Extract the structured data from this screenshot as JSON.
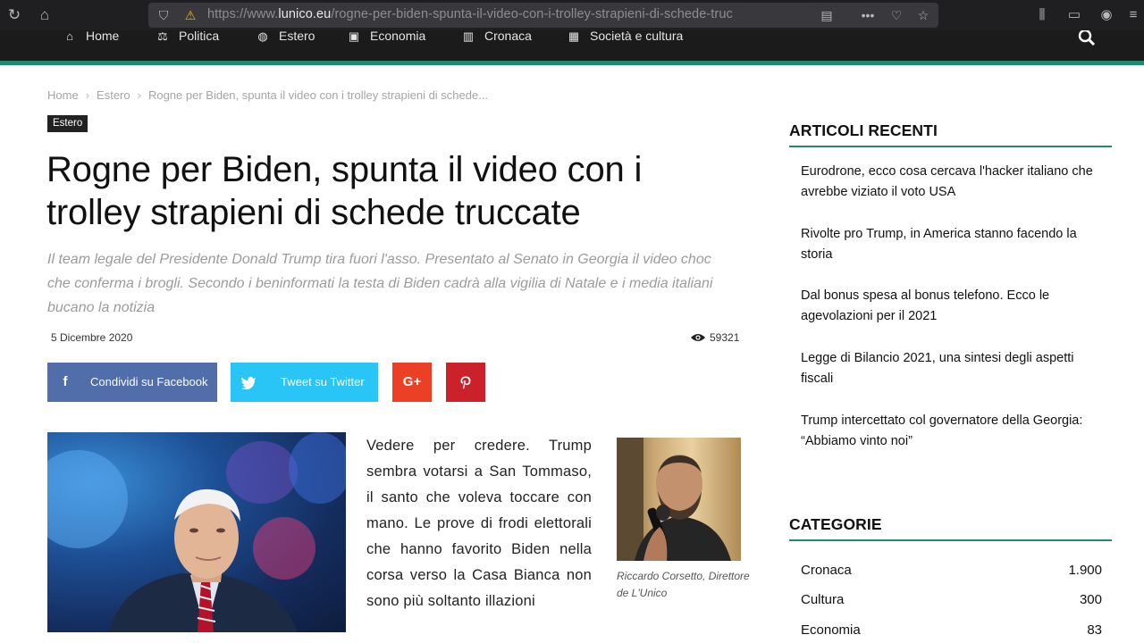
{
  "browser": {
    "url_prefix": "https://www.",
    "url_host": "lunico.eu",
    "url_path": "/rogne-per-biden-spunta-il-video-con-i-trolley-strapieni-di-schede-truc"
  },
  "nav": {
    "items": [
      {
        "label": "Home",
        "icon": "home-icon"
      },
      {
        "label": "Politica",
        "icon": "balance-icon"
      },
      {
        "label": "Estero",
        "icon": "globe-icon"
      },
      {
        "label": "Economia",
        "icon": "money-icon"
      },
      {
        "label": "Cronaca",
        "icon": "newspaper-icon"
      },
      {
        "label": "Società e cultura",
        "icon": "building-icon"
      }
    ]
  },
  "breadcrumb": [
    "Home",
    "Estero",
    "Rogne per Biden, spunta il video con i trolley strapieni di schede..."
  ],
  "article": {
    "category": "Estero",
    "title": "Rogne per Biden, spunta il video con i trolley strapieni di schede truccate",
    "subtitle": "Il team legale del Presidente Donald Trump tira fuori l'asso. Presentato al Senato in Georgia il video choc che conferma i brogli. Secondo i beninformati la testa di Biden cadrà alla vigilia di Natale e i media italiani bucano la notizia",
    "date": "5 Dicembre 2020",
    "views": "59321",
    "share": {
      "facebook": "Condividi su Facebook",
      "twitter": "Tweet su Twitter"
    },
    "body": "Vedere per credere. Trump sembra votarsi a San Tommaso, il santo che voleva toccare con mano. Le prove di frodi elettorali che hanno favorito Biden nella corsa verso la Casa Bianca non sono più soltanto illazioni",
    "author_caption": "Riccardo Corsetto, Direttore de L'Unico"
  },
  "sidebar": {
    "recent_title": "ARTICOLI RECENTI",
    "recent": [
      "Eurodrone, ecco cosa cercava l'hacker italiano che avrebbe viziato il voto USA",
      "Rivolte pro Trump, in America stanno facendo la storia",
      "Dal bonus spesa al bonus telefono. Ecco le agevolazioni per il 2021",
      "Legge di Bilancio 2021, una sintesi degli aspetti fiscali",
      "Trump intercettato col governatore della Georgia: “Abbiamo vinto noi”"
    ],
    "categories_title": "CATEGORIE",
    "categories": [
      {
        "name": "Cronaca",
        "count": "1.900"
      },
      {
        "name": "Cultura",
        "count": "300"
      },
      {
        "name": "Economia",
        "count": "83"
      }
    ]
  },
  "colors": {
    "accent": "#1f8a70",
    "facebook": "#516eab",
    "twitter": "#29c5f6",
    "google": "#eb4026",
    "pinterest": "#ca212a"
  }
}
